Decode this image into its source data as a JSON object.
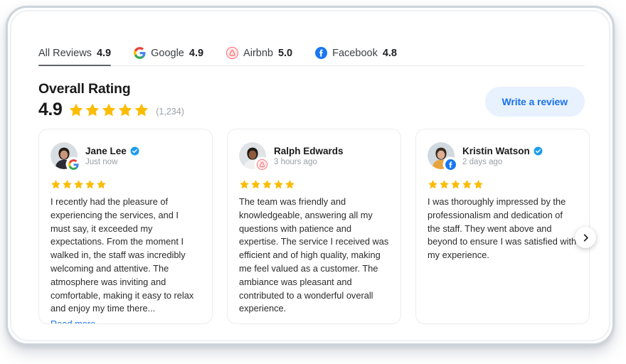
{
  "tabs": [
    {
      "label": "All Reviews",
      "score": "4.9",
      "icon": "none",
      "active": true
    },
    {
      "label": "Google",
      "score": "4.9",
      "icon": "google-icon",
      "active": false
    },
    {
      "label": "Airbnb",
      "score": "5.0",
      "icon": "airbnb-icon",
      "active": false
    },
    {
      "label": "Facebook",
      "score": "4.8",
      "icon": "facebook-icon",
      "active": false
    }
  ],
  "overall": {
    "title": "Overall Rating",
    "score": "4.9",
    "stars": 5,
    "count": "(1,234)"
  },
  "write_review_button": "Write a review",
  "next_arrow_icon": "chevron-right-icon",
  "reviews": [
    {
      "name": "Jane Lee",
      "verified": true,
      "time": "Just now",
      "source": "google-icon",
      "stars": 5,
      "text": "I recently had the pleasure of experiencing the services, and I must say, it exceeded my expectations. From the moment I walked in, the staff was incredibly welcoming and attentive. The atmosphere was inviting and comfortable, making it easy to relax and enjoy my time there...",
      "read_more": "Read more"
    },
    {
      "name": "Ralph Edwards",
      "verified": false,
      "time": "3 hours ago",
      "source": "airbnb-icon",
      "stars": 5,
      "text": "The team was friendly and knowledgeable, answering all my questions with patience and expertise. The service I received was efficient and of high quality, making me feel valued as a customer. The ambiance was pleasant and contributed to a wonderful overall experience.",
      "read_more": ""
    },
    {
      "name": "Kristin Watson",
      "verified": true,
      "time": "2 days ago",
      "source": "facebook-icon",
      "stars": 5,
      "text": "I was thoroughly impressed by the professionalism and dedication of the staff. They went above and beyond to ensure I was satisfied with my experience.",
      "read_more": ""
    }
  ],
  "colors": {
    "star": "#FBBC04",
    "accent_blue": "#1a73e8",
    "button_bg": "#e8f1fe",
    "airbnb": "#FF5A5F",
    "facebook": "#1877F2"
  }
}
